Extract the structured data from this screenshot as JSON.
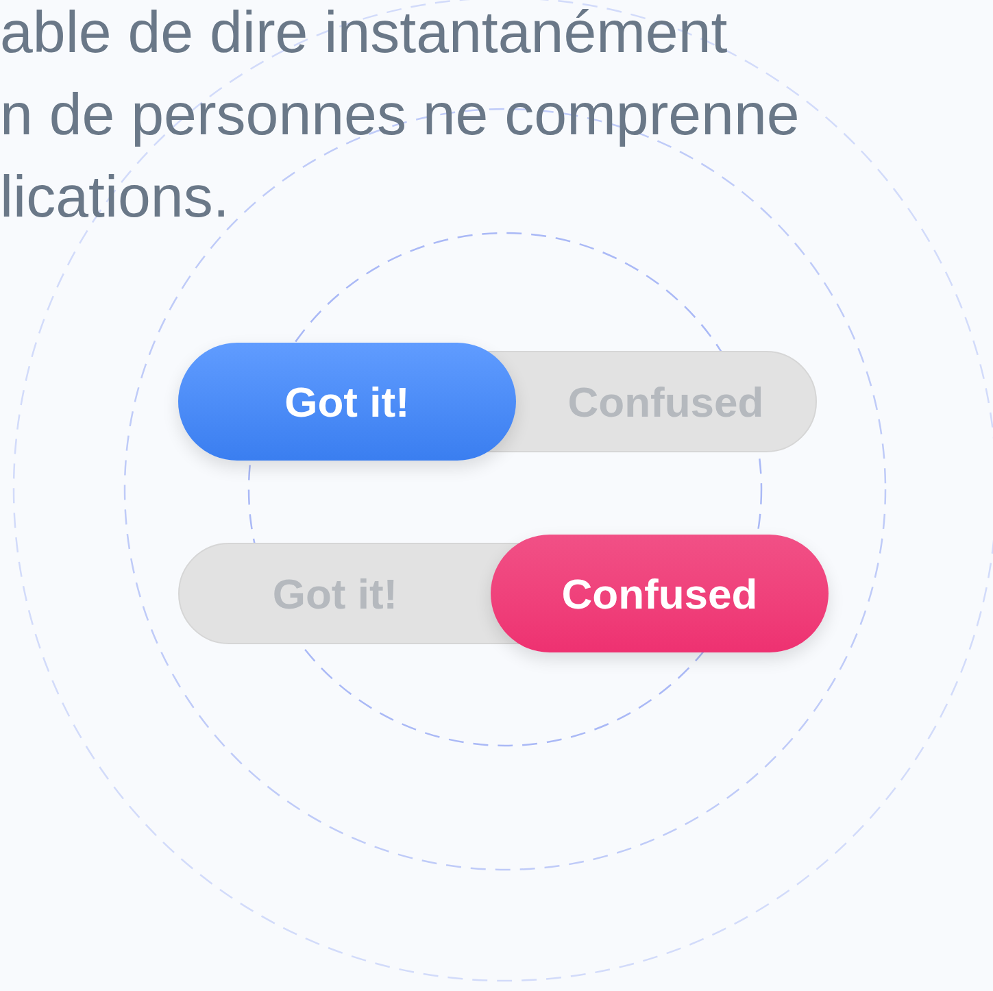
{
  "paragraph_lines": [
    "able de dire instantanément",
    "n de personnes ne comprenne",
    "lications."
  ],
  "toggles": [
    {
      "options": [
        {
          "label": "Got it!",
          "kind": "positive",
          "selected": true
        },
        {
          "label": "Confused",
          "kind": "negative",
          "selected": false
        }
      ]
    },
    {
      "options": [
        {
          "label": "Got it!",
          "kind": "positive",
          "selected": false
        },
        {
          "label": "Confused",
          "kind": "negative",
          "selected": true
        }
      ]
    }
  ]
}
